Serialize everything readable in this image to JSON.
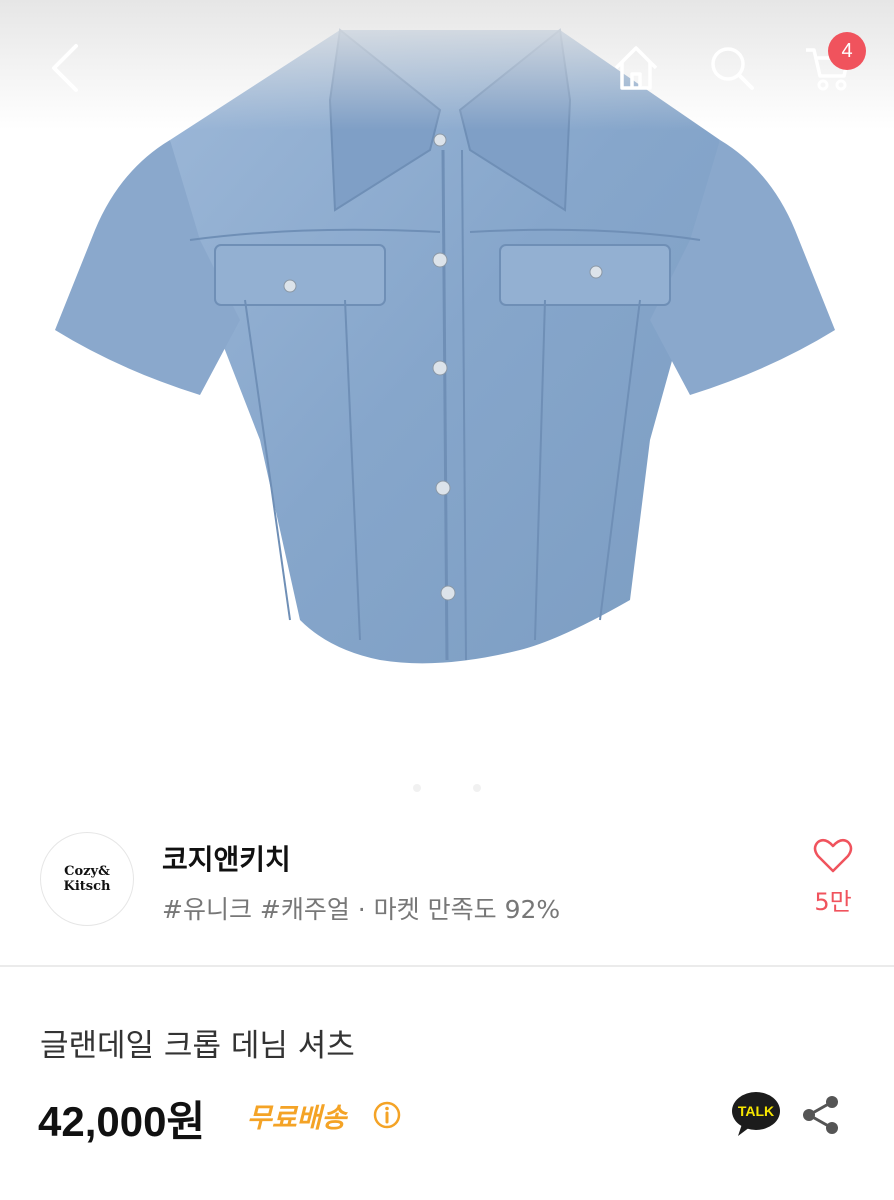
{
  "nav": {
    "cart_count": "4",
    "icons": [
      "back-icon",
      "home-icon",
      "search-icon",
      "cart-icon"
    ]
  },
  "shop": {
    "logo_line1": "Cozy&",
    "logo_line2": "Kitsch",
    "name": "코지앤키치",
    "tags": "#유니크 #캐주얼 · 마켓 만족도 92%",
    "like_count": "5만"
  },
  "product": {
    "title": "글랜데일 크롭 데님 셔츠",
    "price": "42,000원",
    "shipping": "무료배송",
    "talk_label": "TALK"
  },
  "colors": {
    "accent": "#f0535d",
    "shipping": "#f4a326",
    "denim": "#8eadd0"
  }
}
